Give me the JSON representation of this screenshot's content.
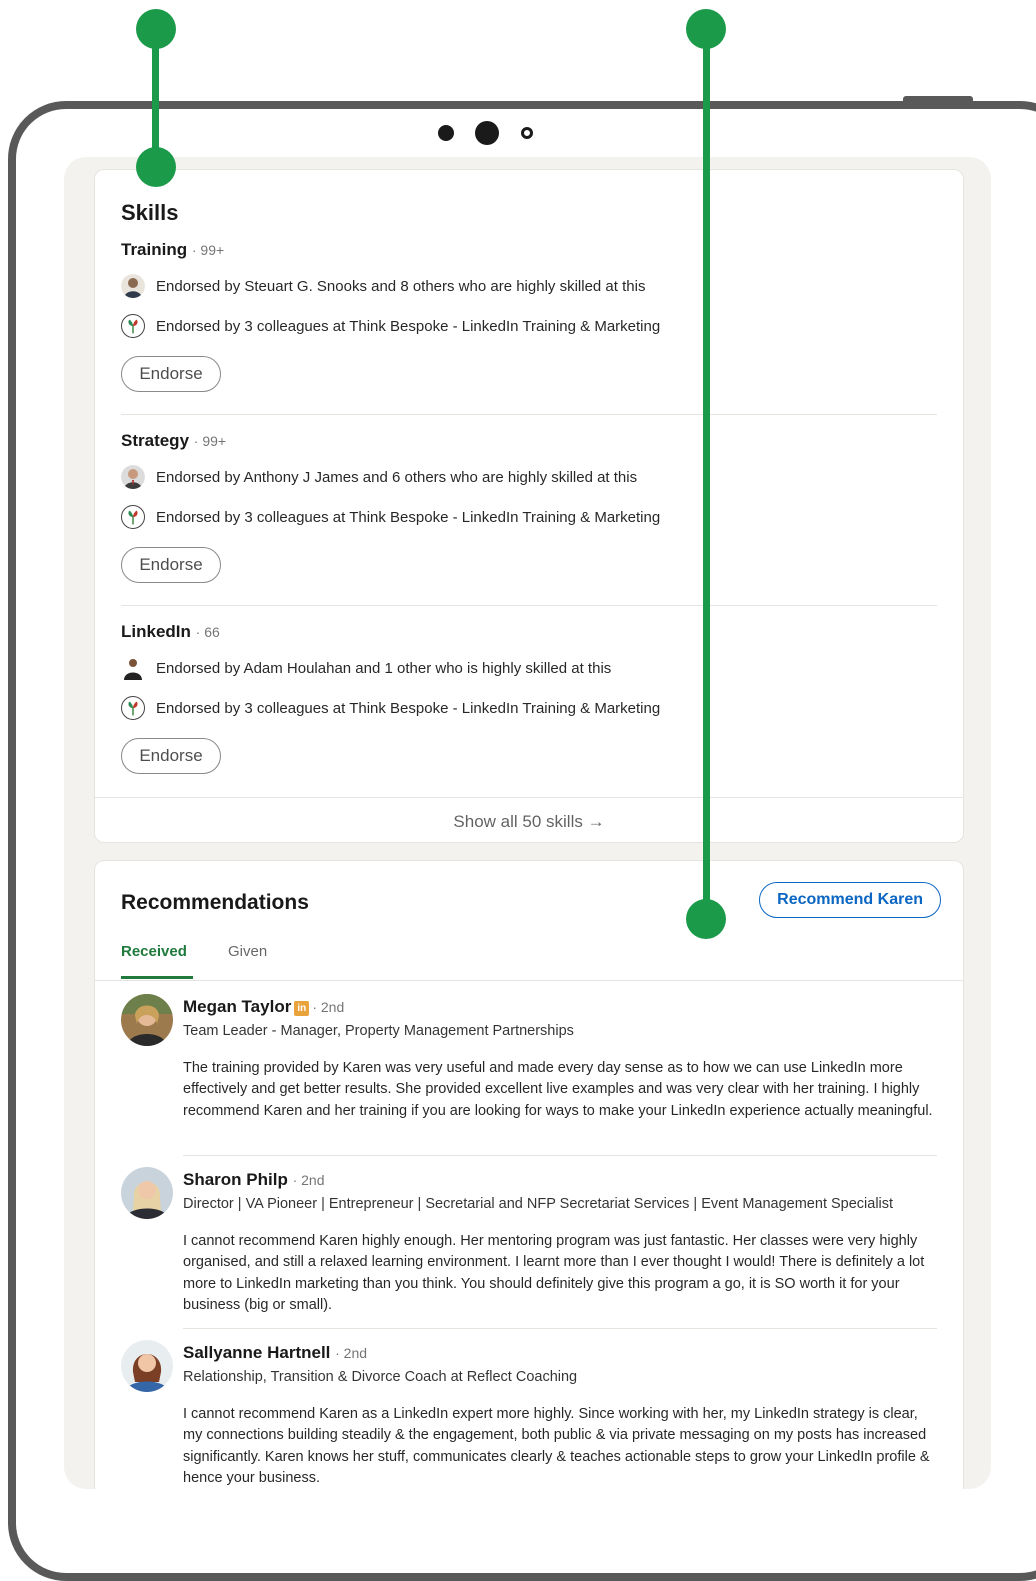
{
  "skills": {
    "title": "Skills",
    "items": [
      {
        "name": "Training",
        "count": "· 99+",
        "endorsed_by_people": "Endorsed by Steuart G. Snooks and 8 others who are highly skilled at this",
        "endorsed_by_colleagues": "Endorsed by 3 colleagues at Think Bespoke - LinkedIn Training & Marketing",
        "endorse_label": "Endorse"
      },
      {
        "name": "Strategy",
        "count": "· 99+",
        "endorsed_by_people": "Endorsed by Anthony J James and 6 others who are highly skilled at this",
        "endorsed_by_colleagues": "Endorsed by 3 colleagues at Think Bespoke - LinkedIn Training & Marketing",
        "endorse_label": "Endorse"
      },
      {
        "name": "LinkedIn",
        "count": "· 66",
        "endorsed_by_people": "Endorsed by Adam Houlahan and 1 other who is highly skilled at this",
        "endorsed_by_colleagues": "Endorsed by 3 colleagues at Think Bespoke - LinkedIn Training & Marketing",
        "endorse_label": "Endorse"
      }
    ],
    "show_all_label": "Show all 50 skills →"
  },
  "recommendations": {
    "title": "Recommendations",
    "recommend_button_label": "Recommend Karen",
    "tabs": [
      {
        "label": "Received",
        "active": true
      },
      {
        "label": "Given",
        "active": false
      }
    ],
    "items": [
      {
        "name": "Megan Taylor",
        "badge": "in",
        "degree": "· 2nd",
        "headline": "Team Leader - Manager, Property Management Partnerships",
        "text": "The training provided by Karen was very useful and made every day sense as to how we can use LinkedIn more effectively and get better results. She provided excellent live examples and was very clear with her training. I highly recommend Karen and her training if you are looking for ways to make your LinkedIn experience actually meaningful."
      },
      {
        "name": "Sharon Philp",
        "degree": "· 2nd",
        "headline": "Director | VA Pioneer | Entrepreneur | Secretarial and NFP Secretariat Services | Event Management Specialist",
        "text": "I cannot recommend Karen highly enough. Her mentoring program was just fantastic. Her classes were very highly organised, and still a relaxed learning environment. I learnt more than I ever thought I would! There is definitely a lot more to LinkedIn marketing than you think. You should definitely give this program a go, it is SO worth it for your business (big or small)."
      },
      {
        "name": "Sallyanne Hartnell",
        "degree": "· 2nd",
        "headline": "Relationship, Transition & Divorce Coach at Reflect Coaching",
        "text": "I cannot recommend Karen as a LinkedIn expert more highly. Since working with her, my LinkedIn strategy is clear, my connections building steadily & the engagement, both public & via private messaging on my posts has increased significantly. Karen knows her stuff, communicates clearly & teaches actionable steps to grow your LinkedIn profile & hence your business."
      }
    ]
  },
  "colors": {
    "pin_green": "#1b9a4a",
    "tab_active_green": "#1f7a3c",
    "link_blue": "#0a66c2",
    "frame_gray": "#595959",
    "screen_background": "#f3f2ef"
  },
  "icons": [
    "avatar-photo-icon",
    "think-bespoke-leaf-logo-icon",
    "linkedin-badge-icon",
    "arrow-right-icon"
  ]
}
